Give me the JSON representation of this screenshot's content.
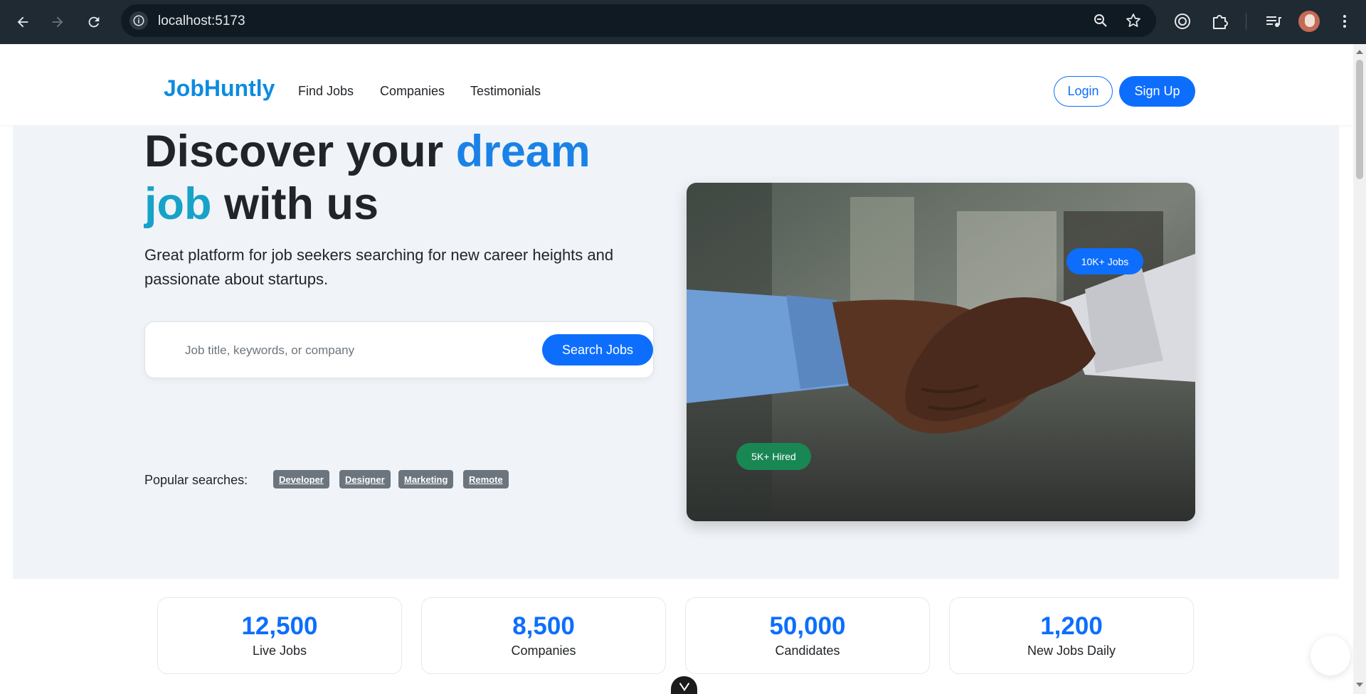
{
  "browser": {
    "url": "localhost:5173",
    "icons": [
      "back-icon",
      "forward-icon",
      "reload-icon",
      "site-info-icon",
      "zoom-icon",
      "bookmark-star-icon",
      "circle-ext-icon",
      "puzzle-extension-icon",
      "media-queue-icon",
      "profile-avatar",
      "more-menu-icon"
    ]
  },
  "nav": {
    "brand": "JobHuntly",
    "links": [
      "Find Jobs",
      "Companies",
      "Testimonials"
    ],
    "login": "Login",
    "signup": "Sign Up"
  },
  "hero": {
    "headline_part1": "Discover your ",
    "headline_accent1": "dream",
    "headline_accent2": "job",
    "headline_part2": " with us",
    "subtitle": "Great platform for job seekers searching for new career heights and passionate about startups.",
    "search_placeholder": "Job title, keywords, or company",
    "search_button": "Search Jobs",
    "popular_label": "Popular searches:",
    "popular_tags": [
      "Developer",
      "Designer",
      "Marketing",
      "Remote"
    ],
    "image_badge_jobs": "10K+ Jobs",
    "image_badge_hired": "5K+ Hired"
  },
  "stats": [
    {
      "value": "12,500",
      "label": "Live Jobs"
    },
    {
      "value": "8,500",
      "label": "Companies"
    },
    {
      "value": "50,000",
      "label": "Candidates"
    },
    {
      "value": "1,200",
      "label": "New Jobs Daily"
    }
  ],
  "colors": {
    "primary": "#0d6efd",
    "brand": "#0d8be0",
    "success": "#198754",
    "hero_bg": "#f0f4f8"
  }
}
